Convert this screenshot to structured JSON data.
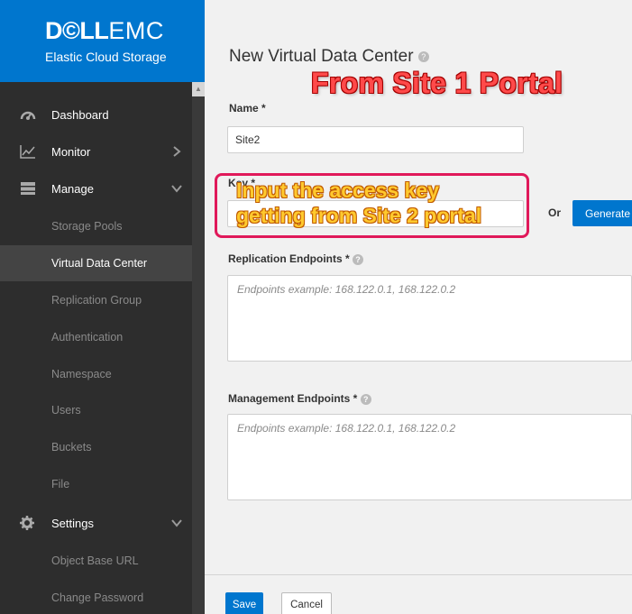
{
  "brand": {
    "logo_bold": "D©LL",
    "logo_light": "EMC",
    "product": "Elastic Cloud Storage"
  },
  "sidebar": {
    "items": [
      {
        "label": "Dashboard",
        "icon": "dashboard-icon"
      },
      {
        "label": "Monitor",
        "icon": "chart-line-icon",
        "arrow": "chevron-right-icon"
      },
      {
        "label": "Manage",
        "icon": "server-icon",
        "arrow": "chevron-down-icon"
      }
    ],
    "manage_sub": [
      "Storage Pools",
      "Virtual Data Center",
      "Replication Group",
      "Authentication",
      "Namespace",
      "Users",
      "Buckets",
      "File"
    ],
    "active_sub": "Virtual Data Center",
    "settings": {
      "label": "Settings",
      "icon": "gear-icon",
      "arrow": "chevron-down-icon"
    },
    "settings_sub": [
      "Object Base URL",
      "Change Password"
    ]
  },
  "form": {
    "title": "New Virtual Data Center",
    "name_label": "Name *",
    "name_value": "Site2",
    "key_label": "Key *",
    "key_value": "",
    "or_label": "Or",
    "generate_label": "Generate",
    "replication_label": "Replication Endpoints *",
    "replication_placeholder": "Endpoints example: 168.122.0.1, 168.122.0.2",
    "management_label": "Management Endpoints *",
    "management_placeholder": "Endpoints example: 168.122.0.1, 168.122.0.2",
    "save_label": "Save",
    "cancel_label": "Cancel"
  },
  "annotations": {
    "title": "From Site 1 Portal",
    "note_line1": "Input the access key",
    "note_line2": "getting from Site 2 portal"
  },
  "colors": {
    "brand_blue": "#0076ce",
    "sidebar_bg": "#2d2d2d",
    "annotation_red": "#ff4a4a",
    "annotation_yellow": "#ffc92e",
    "highlight_border": "#e0195a"
  }
}
